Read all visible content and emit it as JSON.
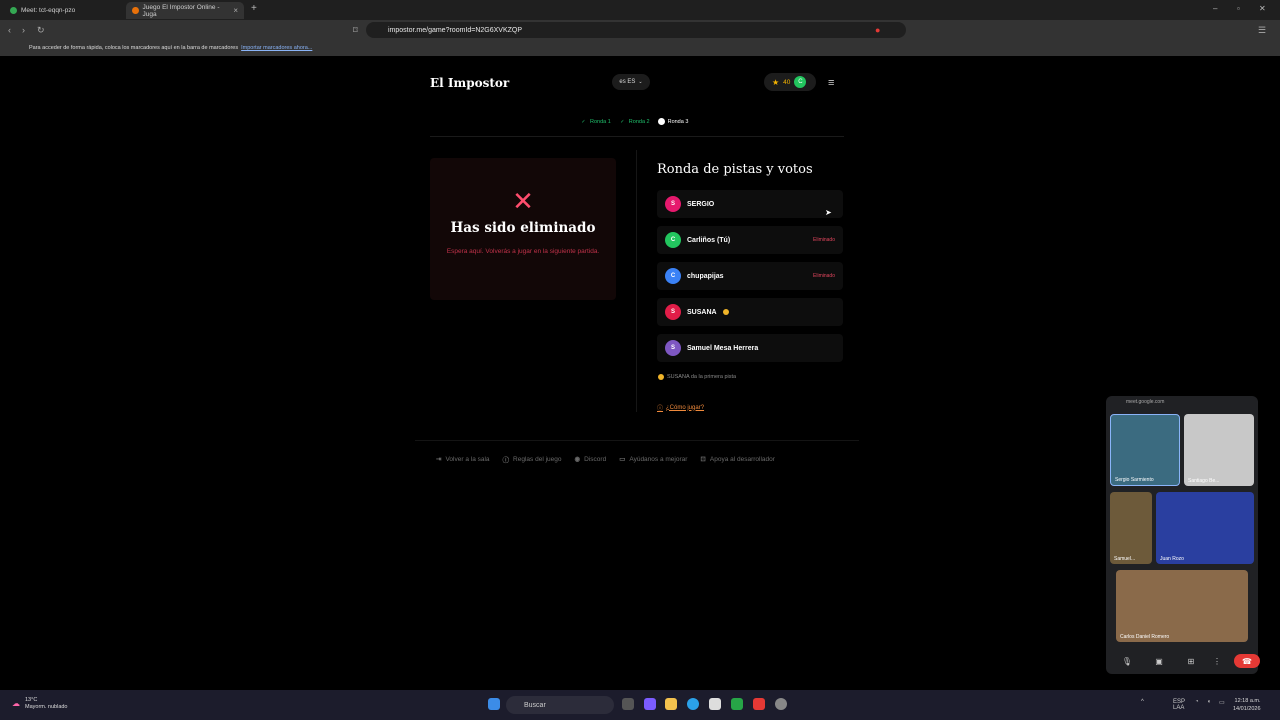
{
  "browser": {
    "tabs": [
      {
        "title": "Meet: tct-eqqn-pzo",
        "active": false
      },
      {
        "title": "Juego El Impostor Online - Juga",
        "active": true
      }
    ],
    "url": "impostor.me/game?roomId=N2G6XVKZQP",
    "bookmarks_bar": {
      "text": "Para acceder de forma rápida, coloca los marcadores aquí en la barra de marcadores",
      "link": "Importar marcadores ahora..."
    }
  },
  "header": {
    "logo": "El Impostor",
    "lang_code": "ES",
    "lang_prefix": "es",
    "coins": "40",
    "avatar_initial": "C"
  },
  "rounds": [
    {
      "label": "Ronda 1",
      "done": true
    },
    {
      "label": "Ronda 2",
      "done": true
    },
    {
      "label": "Ronda 3",
      "done": false
    }
  ],
  "eliminated": {
    "title": "Has sido eliminado",
    "message": "Espera aquí. Volverás a jugar en la siguiente partida."
  },
  "round_panel": {
    "title": "Ronda de pistas y votos",
    "players": [
      {
        "initial": "S",
        "name": "SERGIO",
        "status": "",
        "color": "#e6196d"
      },
      {
        "initial": "C",
        "name": "Carliños (Tú)",
        "status": "Eliminado",
        "color": "#22c55e"
      },
      {
        "initial": "C",
        "name": "chupapijas",
        "status": "Eliminado",
        "color": "#3b82f6"
      },
      {
        "initial": "S",
        "name": "SUSANA",
        "status": "",
        "color": "#e11d48"
      },
      {
        "initial": "S",
        "name": "Samuel Mesa Herrera",
        "status": "",
        "color": "#7e57c2"
      }
    ],
    "hint": "SUSANA da la primera pista",
    "how_to": "¿Cómo jugar?"
  },
  "footer": [
    "Volver a la sala",
    "Reglas del juego",
    "Discord",
    "Ayúdanos a mejorar",
    "Apoya al desarrollador"
  ],
  "meet": {
    "domain": "meet.google.com",
    "participants": [
      "Sergio Sarmiento",
      "Santiago Be...",
      "Samuel...",
      "Juan Rozo",
      "Carlos Daniel Romero"
    ]
  },
  "taskbar": {
    "search": "Buscar",
    "weather_temp": "13°C",
    "weather_desc": "Mayorm. nublado",
    "lang": "ESP",
    "region": "LAA",
    "time": "12:18 a.m.",
    "date": "14/01/2026"
  },
  "colors": {
    "accent_green": "#1fbf6b",
    "danger": "#e0455d",
    "coin": "#f5b400"
  }
}
